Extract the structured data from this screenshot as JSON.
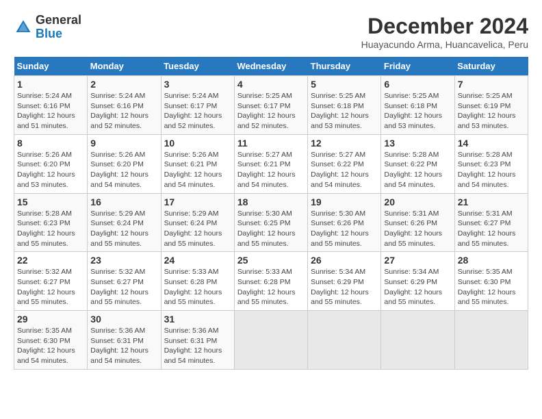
{
  "header": {
    "logo_line1": "General",
    "logo_line2": "Blue",
    "month_title": "December 2024",
    "location": "Huayacundo Arma, Huancavelica, Peru"
  },
  "days_of_week": [
    "Sunday",
    "Monday",
    "Tuesday",
    "Wednesday",
    "Thursday",
    "Friday",
    "Saturday"
  ],
  "weeks": [
    [
      {
        "day": "1",
        "sunrise": "5:24 AM",
        "sunset": "6:16 PM",
        "daylight": "12 hours and 51 minutes."
      },
      {
        "day": "2",
        "sunrise": "5:24 AM",
        "sunset": "6:16 PM",
        "daylight": "12 hours and 52 minutes."
      },
      {
        "day": "3",
        "sunrise": "5:24 AM",
        "sunset": "6:17 PM",
        "daylight": "12 hours and 52 minutes."
      },
      {
        "day": "4",
        "sunrise": "5:25 AM",
        "sunset": "6:17 PM",
        "daylight": "12 hours and 52 minutes."
      },
      {
        "day": "5",
        "sunrise": "5:25 AM",
        "sunset": "6:18 PM",
        "daylight": "12 hours and 53 minutes."
      },
      {
        "day": "6",
        "sunrise": "5:25 AM",
        "sunset": "6:18 PM",
        "daylight": "12 hours and 53 minutes."
      },
      {
        "day": "7",
        "sunrise": "5:25 AM",
        "sunset": "6:19 PM",
        "daylight": "12 hours and 53 minutes."
      }
    ],
    [
      {
        "day": "8",
        "sunrise": "5:26 AM",
        "sunset": "6:20 PM",
        "daylight": "12 hours and 53 minutes."
      },
      {
        "day": "9",
        "sunrise": "5:26 AM",
        "sunset": "6:20 PM",
        "daylight": "12 hours and 54 minutes."
      },
      {
        "day": "10",
        "sunrise": "5:26 AM",
        "sunset": "6:21 PM",
        "daylight": "12 hours and 54 minutes."
      },
      {
        "day": "11",
        "sunrise": "5:27 AM",
        "sunset": "6:21 PM",
        "daylight": "12 hours and 54 minutes."
      },
      {
        "day": "12",
        "sunrise": "5:27 AM",
        "sunset": "6:22 PM",
        "daylight": "12 hours and 54 minutes."
      },
      {
        "day": "13",
        "sunrise": "5:28 AM",
        "sunset": "6:22 PM",
        "daylight": "12 hours and 54 minutes."
      },
      {
        "day": "14",
        "sunrise": "5:28 AM",
        "sunset": "6:23 PM",
        "daylight": "12 hours and 54 minutes."
      }
    ],
    [
      {
        "day": "15",
        "sunrise": "5:28 AM",
        "sunset": "6:23 PM",
        "daylight": "12 hours and 55 minutes."
      },
      {
        "day": "16",
        "sunrise": "5:29 AM",
        "sunset": "6:24 PM",
        "daylight": "12 hours and 55 minutes."
      },
      {
        "day": "17",
        "sunrise": "5:29 AM",
        "sunset": "6:24 PM",
        "daylight": "12 hours and 55 minutes."
      },
      {
        "day": "18",
        "sunrise": "5:30 AM",
        "sunset": "6:25 PM",
        "daylight": "12 hours and 55 minutes."
      },
      {
        "day": "19",
        "sunrise": "5:30 AM",
        "sunset": "6:26 PM",
        "daylight": "12 hours and 55 minutes."
      },
      {
        "day": "20",
        "sunrise": "5:31 AM",
        "sunset": "6:26 PM",
        "daylight": "12 hours and 55 minutes."
      },
      {
        "day": "21",
        "sunrise": "5:31 AM",
        "sunset": "6:27 PM",
        "daylight": "12 hours and 55 minutes."
      }
    ],
    [
      {
        "day": "22",
        "sunrise": "5:32 AM",
        "sunset": "6:27 PM",
        "daylight": "12 hours and 55 minutes."
      },
      {
        "day": "23",
        "sunrise": "5:32 AM",
        "sunset": "6:27 PM",
        "daylight": "12 hours and 55 minutes."
      },
      {
        "day": "24",
        "sunrise": "5:33 AM",
        "sunset": "6:28 PM",
        "daylight": "12 hours and 55 minutes."
      },
      {
        "day": "25",
        "sunrise": "5:33 AM",
        "sunset": "6:28 PM",
        "daylight": "12 hours and 55 minutes."
      },
      {
        "day": "26",
        "sunrise": "5:34 AM",
        "sunset": "6:29 PM",
        "daylight": "12 hours and 55 minutes."
      },
      {
        "day": "27",
        "sunrise": "5:34 AM",
        "sunset": "6:29 PM",
        "daylight": "12 hours and 55 minutes."
      },
      {
        "day": "28",
        "sunrise": "5:35 AM",
        "sunset": "6:30 PM",
        "daylight": "12 hours and 55 minutes."
      }
    ],
    [
      {
        "day": "29",
        "sunrise": "5:35 AM",
        "sunset": "6:30 PM",
        "daylight": "12 hours and 54 minutes."
      },
      {
        "day": "30",
        "sunrise": "5:36 AM",
        "sunset": "6:31 PM",
        "daylight": "12 hours and 54 minutes."
      },
      {
        "day": "31",
        "sunrise": "5:36 AM",
        "sunset": "6:31 PM",
        "daylight": "12 hours and 54 minutes."
      },
      null,
      null,
      null,
      null
    ]
  ]
}
